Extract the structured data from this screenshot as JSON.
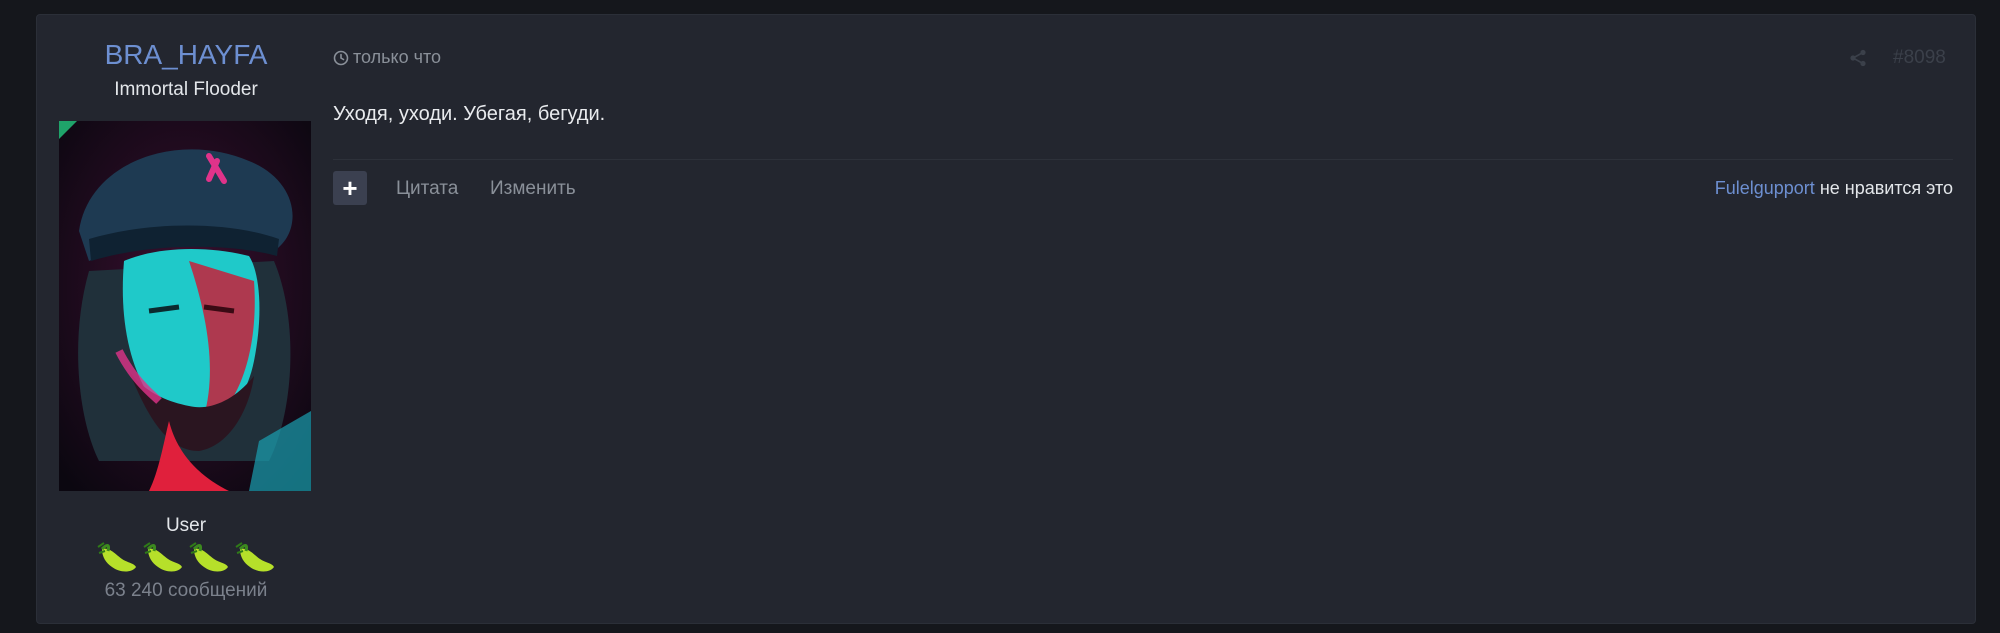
{
  "user": {
    "name": "BRA_HAYFA",
    "title": "Immortal Flooder",
    "role": "User",
    "badges": [
      "chili-badge",
      "chili-badge",
      "chili-badge",
      "chili-badge"
    ],
    "message_count": "63 240 сообщений"
  },
  "post": {
    "time": "только что",
    "number": "#8098",
    "text": "Уходя, уходи. Убегая, бегуди."
  },
  "actions": {
    "plus_label": "+",
    "quote_label": "Цитата",
    "edit_label": "Изменить"
  },
  "reaction": {
    "user": "Fulelgupport",
    "text": "не нравится это"
  },
  "colors": {
    "accent": "#6d8fd1",
    "online": "#1fa36a",
    "background": "#23262f"
  }
}
